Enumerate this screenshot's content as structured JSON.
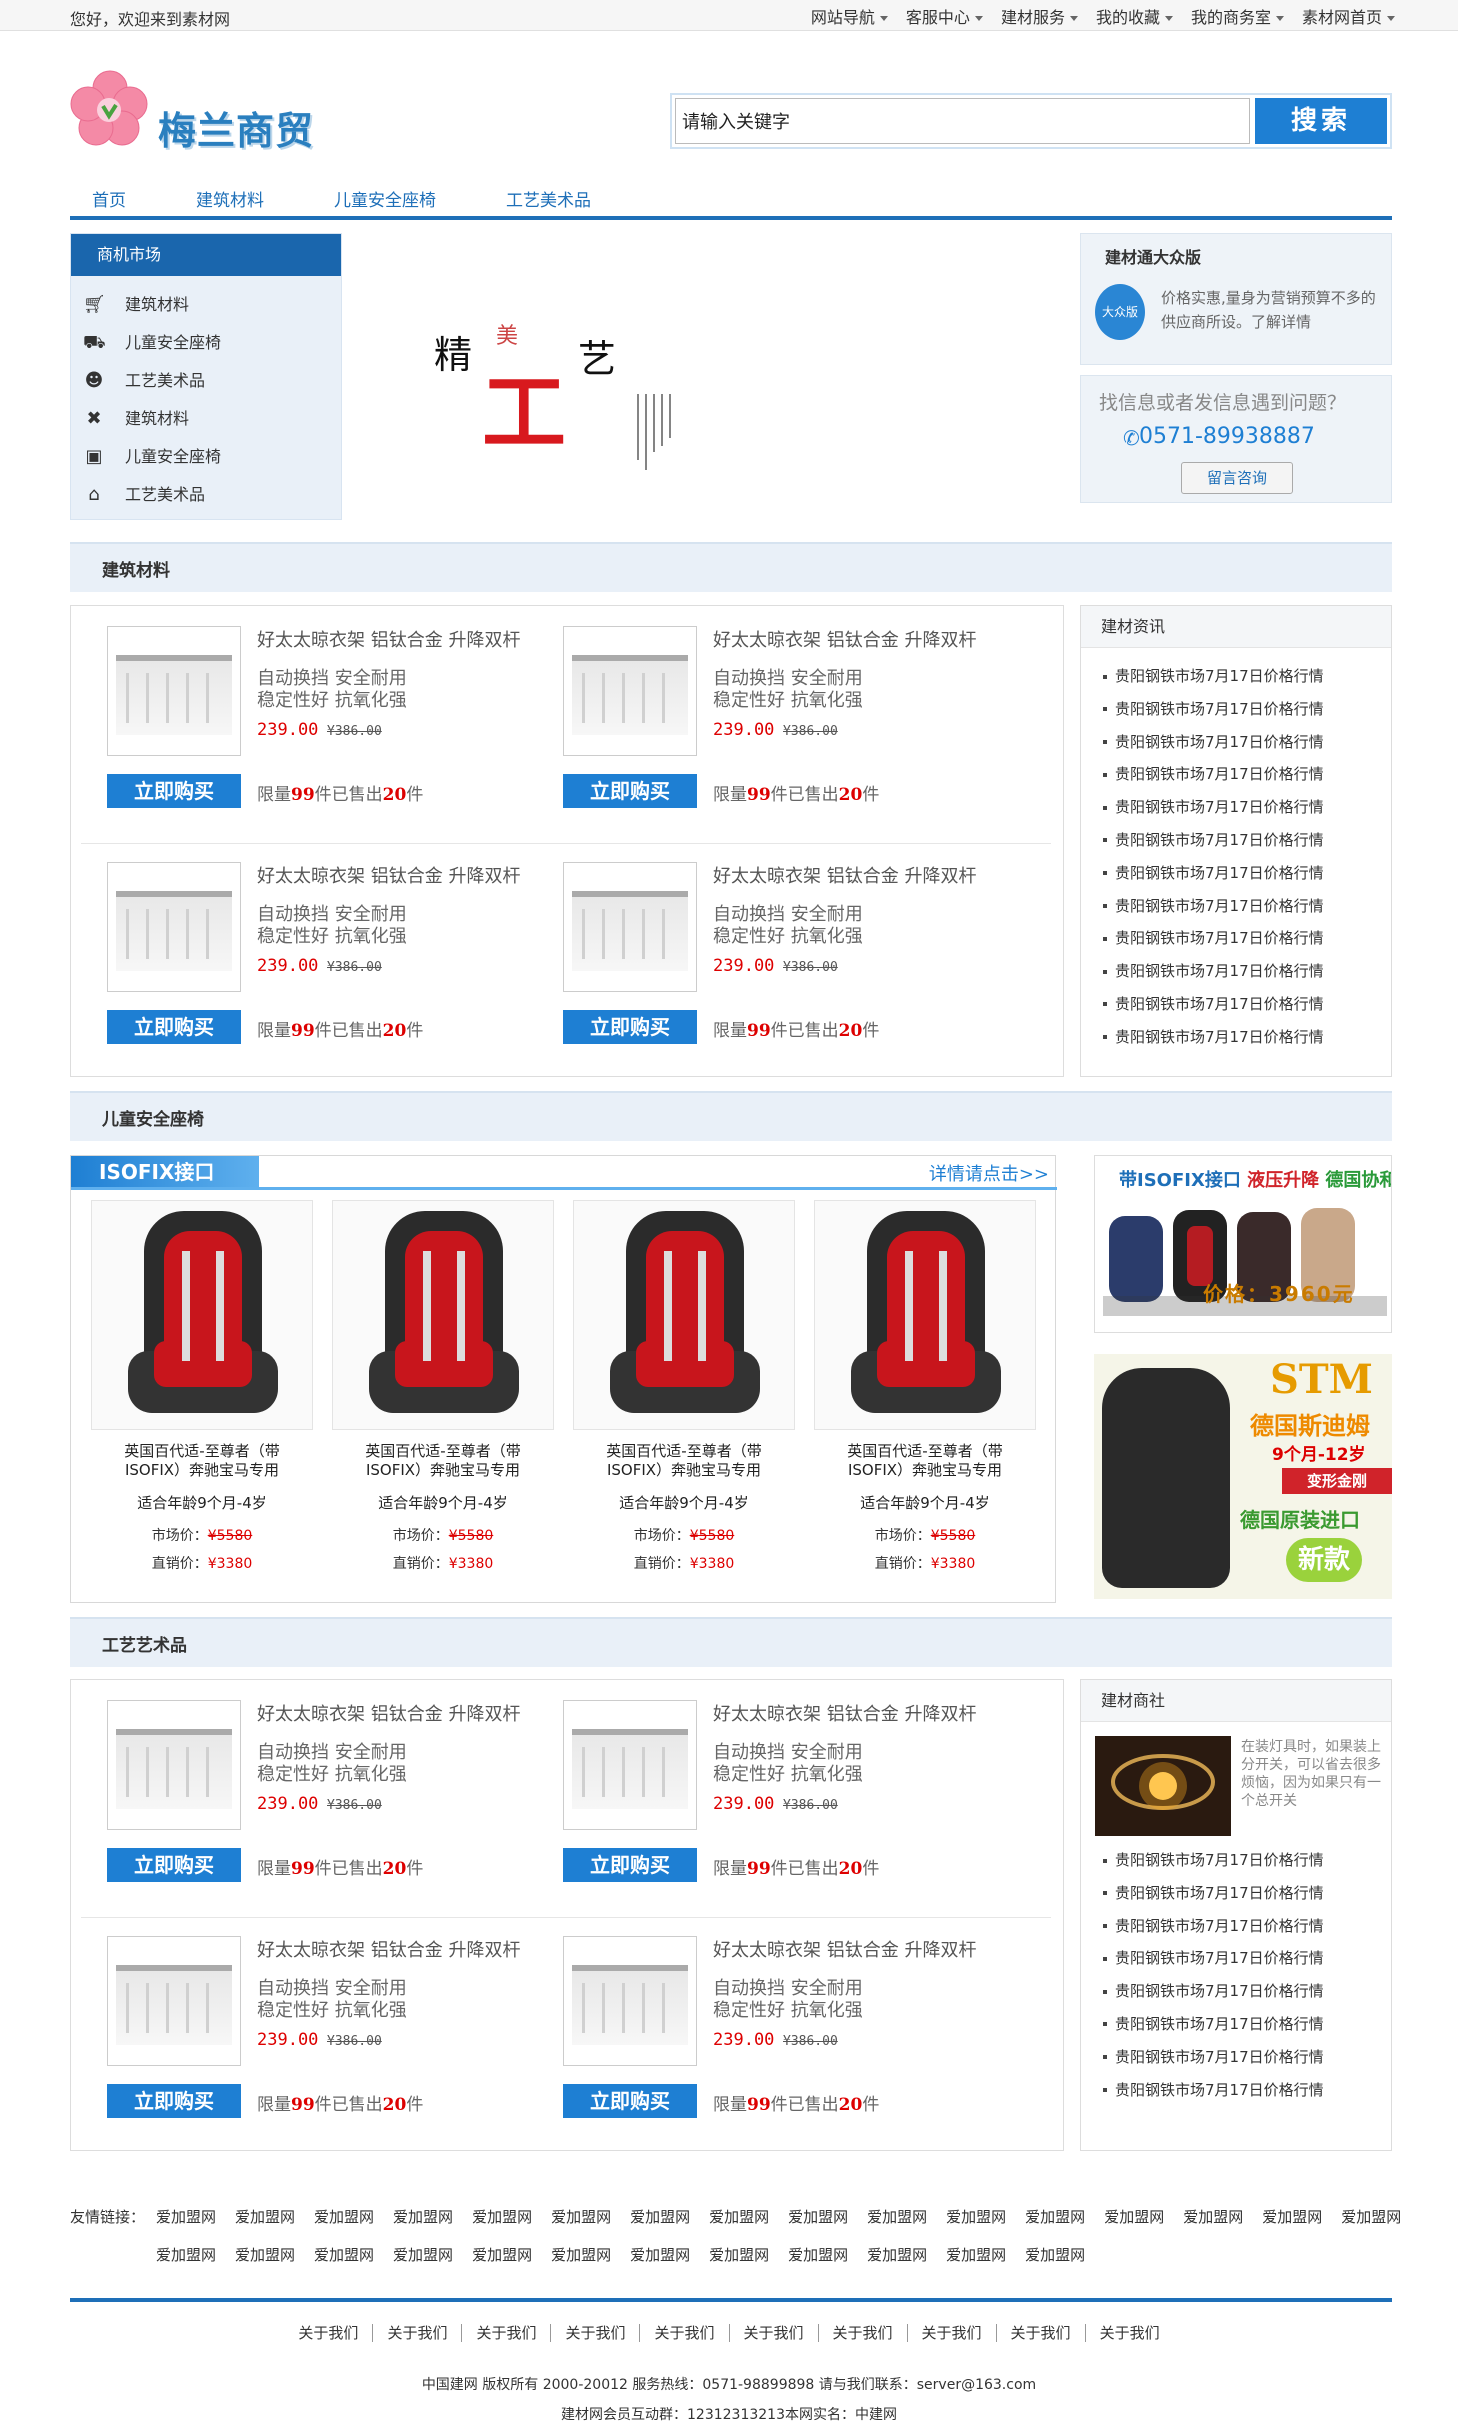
{
  "topbar": {
    "welcome": "您好，欢迎来到素材网",
    "nav": [
      "网站导航",
      "客服中心",
      "建材服务",
      "我的收藏",
      "我的商务室",
      "素材网首页"
    ]
  },
  "logo": {
    "text": "梅兰商贸"
  },
  "search": {
    "placeholder": "请输入关键字",
    "button": "搜索"
  },
  "mainnav": [
    "首页",
    "建筑材料",
    "儿童安全座椅",
    "工艺美术品"
  ],
  "market": {
    "title": "商机市场",
    "items": [
      {
        "icon": "cart-icon",
        "label": "建筑材料"
      },
      {
        "icon": "car-icon",
        "label": "儿童安全座椅"
      },
      {
        "icon": "users-icon",
        "label": "工艺美术品"
      },
      {
        "icon": "tools-icon",
        "label": "建筑材料"
      },
      {
        "icon": "blogger-icon",
        "label": "儿童安全座椅"
      },
      {
        "icon": "bank-icon",
        "label": "工艺美术品"
      }
    ]
  },
  "banner": {
    "c1": "精",
    "c2": "美",
    "c3": "工",
    "c4": "艺"
  },
  "dzb": {
    "title": "建材通大众版",
    "badge": "大众版",
    "desc": "价格实惠,量身为营销预算不多的供应商所设。了解详情"
  },
  "help": {
    "question": "找信息或者发信息遇到问题？",
    "phone": "0571-89938887",
    "button": "留言咨询"
  },
  "sections": {
    "building": "建筑材料",
    "seats": "儿童安全座椅",
    "crafts": "工艺艺术品"
  },
  "product": {
    "title": "好太太晾衣架 铝钛合金 升降双杆",
    "desc1": "自动换挡 安全耐用",
    "desc2": "稳定性好 抗氧化强",
    "price": "239.00",
    "old_price": "¥386.00",
    "buy": "立即购买",
    "limit_pre": "限量",
    "limit_num": "99",
    "limit_mid": "件已售出",
    "sold_num": "20",
    "limit_post": "件"
  },
  "news": {
    "title": "建材资讯",
    "items": [
      "贵阳钢铁市场7月17日价格行情",
      "贵阳钢铁市场7月17日价格行情",
      "贵阳钢铁市场7月17日价格行情",
      "贵阳钢铁市场7月17日价格行情",
      "贵阳钢铁市场7月17日价格行情",
      "贵阳钢铁市场7月17日价格行情",
      "贵阳钢铁市场7月17日价格行情",
      "贵阳钢铁市场7月17日价格行情",
      "贵阳钢铁市场7月17日价格行情",
      "贵阳钢铁市场7月17日价格行情",
      "贵阳钢铁市场7月17日价格行情",
      "贵阳钢铁市场7月17日价格行情"
    ]
  },
  "isofix": {
    "tab": "ISOFIX接口",
    "more": "详情请点击>>",
    "seat": {
      "name1": "英国百代适-至尊者（带",
      "name2": "ISOFIX）奔驰宝马专用",
      "age": "适合年龄9个月-4岁",
      "market_label": "市场价：",
      "market_price": "¥5580",
      "direct_label": "直销价：",
      "direct_price": "¥3380"
    }
  },
  "ad1": {
    "t_a": "带ISOFIX接口",
    "t_b": "液压升降",
    "t_c": "德国协和",
    "price": "价格：3960元"
  },
  "ad2": {
    "stm": "STM",
    "de": "德国斯迪姆",
    "age": "9个月-12岁",
    "box": "变形金刚",
    "import": "德国原装进口",
    "new": "新款"
  },
  "shangshe": {
    "title": "建材商社",
    "desc": "在装灯具时，如果装上分开关，可以省去很多烦恼，因为如果只有一个总开关",
    "items": [
      "贵阳钢铁市场7月17日价格行情",
      "贵阳钢铁市场7月17日价格行情",
      "贵阳钢铁市场7月17日价格行情",
      "贵阳钢铁市场7月17日价格行情",
      "贵阳钢铁市场7月17日价格行情",
      "贵阳钢铁市场7月17日价格行情",
      "贵阳钢铁市场7月17日价格行情",
      "贵阳钢铁市场7月17日价格行情"
    ]
  },
  "links": {
    "label": "友情链接：",
    "row1": [
      "爱加盟网",
      "爱加盟网",
      "爱加盟网",
      "爱加盟网",
      "爱加盟网",
      "爱加盟网",
      "爱加盟网",
      "爱加盟网",
      "爱加盟网",
      "爱加盟网",
      "爱加盟网",
      "爱加盟网",
      "爱加盟网",
      "爱加盟网",
      "爱加盟网",
      "爱加盟网"
    ],
    "row2": [
      "爱加盟网",
      "爱加盟网",
      "爱加盟网",
      "爱加盟网",
      "爱加盟网",
      "爱加盟网",
      "爱加盟网",
      "爱加盟网",
      "爱加盟网",
      "爱加盟网",
      "爱加盟网",
      "爱加盟网"
    ]
  },
  "footer": {
    "nav": [
      "关于我们",
      "关于我们",
      "关于我们",
      "关于我们",
      "关于我们",
      "关于我们",
      "关于我们",
      "关于我们",
      "关于我们",
      "关于我们"
    ],
    "copyright": "中国建网 版权所有 2000-20012 服务热线：0571-98899898 请与我们联系：server@163.com",
    "qq": "建材网会员互动群：12312313213本网实名：中建网"
  }
}
